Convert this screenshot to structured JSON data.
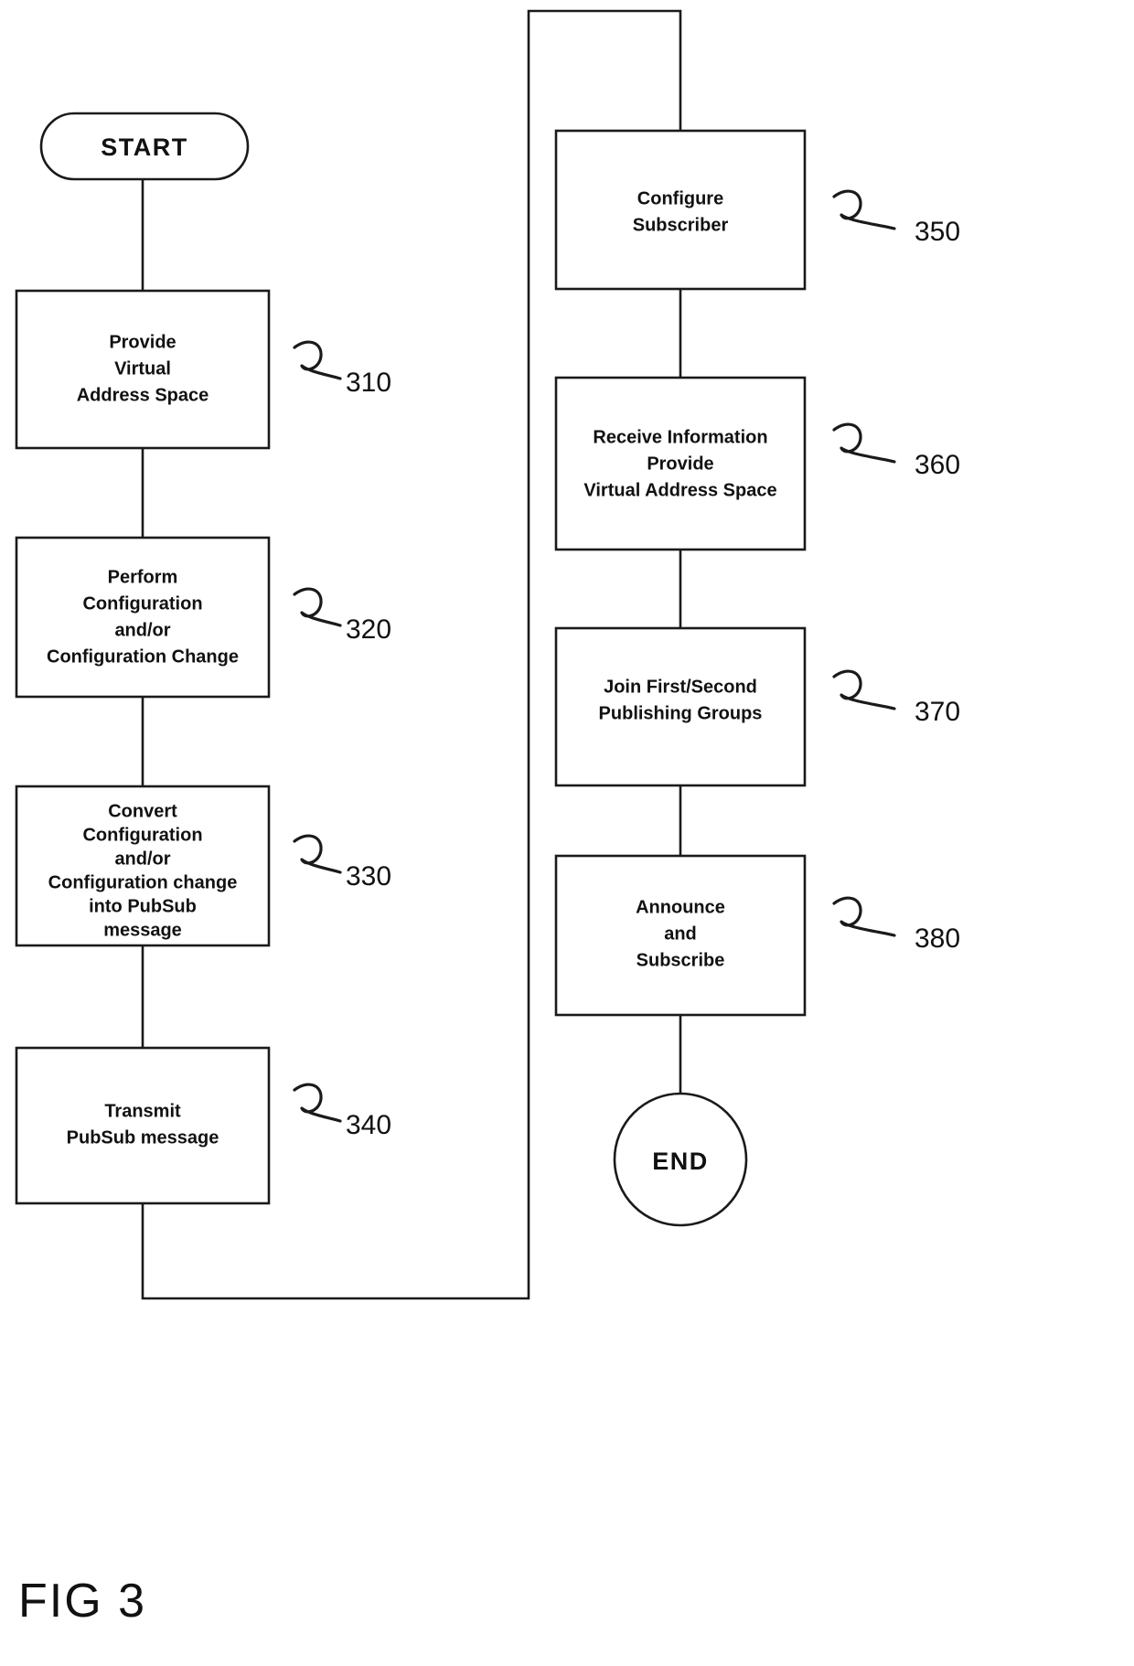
{
  "figure": {
    "label": "FIG 3",
    "type": "flowchart"
  },
  "terminals": {
    "start": "START",
    "end": "END"
  },
  "left_column": [
    {
      "ref": "310",
      "lines": [
        "Provide",
        "Virtual",
        "Address Space"
      ]
    },
    {
      "ref": "320",
      "lines": [
        "Perform",
        "Configuration",
        "and/or",
        "Configuration Change"
      ]
    },
    {
      "ref": "330",
      "lines": [
        "Convert",
        "Configuration",
        "and/or",
        "Configuration change",
        "into PubSub",
        "message"
      ]
    },
    {
      "ref": "340",
      "lines": [
        "Transmit",
        "PubSub message"
      ]
    }
  ],
  "right_column": [
    {
      "ref": "350",
      "lines": [
        "Configure",
        "Subscriber"
      ]
    },
    {
      "ref": "360",
      "lines": [
        "Receive Information",
        "Provide",
        "Virtual Address Space"
      ]
    },
    {
      "ref": "370",
      "lines": [
        "Join First/Second",
        "Publishing Groups"
      ]
    },
    {
      "ref": "380",
      "lines": [
        "Announce",
        "and",
        "Subscribe"
      ]
    }
  ],
  "colors": {
    "ink": "#1a1a1a",
    "background": "#ffffff"
  }
}
